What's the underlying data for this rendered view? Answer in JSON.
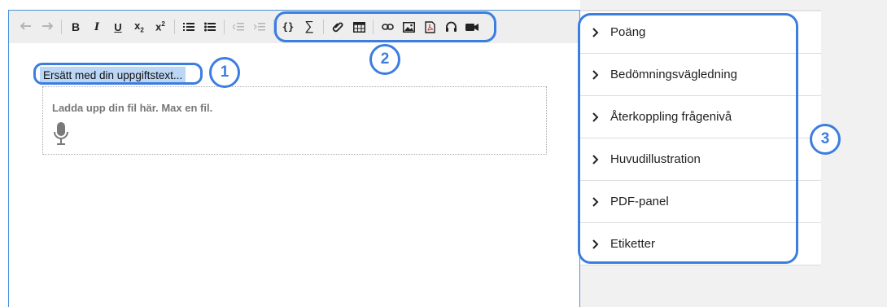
{
  "toolbar": {
    "buttons": [
      {
        "name": "undo-icon",
        "glyph": "↶",
        "enabled": false
      },
      {
        "name": "redo-icon",
        "glyph": "↷",
        "enabled": false
      },
      {
        "name": "bold-icon",
        "glyph": "B",
        "enabled": true
      },
      {
        "name": "italic-icon",
        "glyph": "I",
        "enabled": true
      },
      {
        "name": "underline-icon",
        "glyph": "U",
        "enabled": true
      },
      {
        "name": "subscript-icon",
        "glyph": "x₂",
        "enabled": true
      },
      {
        "name": "superscript-icon",
        "glyph": "x²",
        "enabled": true
      },
      {
        "name": "ordered-list-icon",
        "glyph": "",
        "enabled": true
      },
      {
        "name": "bullet-list-icon",
        "glyph": "",
        "enabled": true
      },
      {
        "name": "outdent-icon",
        "glyph": "",
        "enabled": false
      },
      {
        "name": "indent-icon",
        "glyph": "",
        "enabled": false
      },
      {
        "name": "code-braces-icon",
        "glyph": "{}",
        "enabled": true
      },
      {
        "name": "sigma-icon",
        "glyph": "∑",
        "enabled": true
      },
      {
        "name": "attachment-icon",
        "glyph": "",
        "enabled": true
      },
      {
        "name": "table-icon",
        "glyph": "",
        "enabled": true
      },
      {
        "name": "link-icon",
        "glyph": "",
        "enabled": true
      },
      {
        "name": "image-icon",
        "glyph": "",
        "enabled": true
      },
      {
        "name": "pdf-icon",
        "glyph": "",
        "enabled": true
      },
      {
        "name": "audio-icon",
        "glyph": "",
        "enabled": true
      },
      {
        "name": "video-icon",
        "glyph": "",
        "enabled": true
      }
    ]
  },
  "editor": {
    "selected_text": "Ersätt med din uppgiftstext...",
    "upload_text": "Ladda upp din fil här. Max en fil."
  },
  "sidebar": {
    "items": [
      {
        "label": "Poäng"
      },
      {
        "label": "Bedömningsvägledning"
      },
      {
        "label": "Återkoppling frågenivå"
      },
      {
        "label": "Huvudillustration"
      },
      {
        "label": "PDF-panel"
      },
      {
        "label": "Etiketter"
      }
    ]
  },
  "annotations": {
    "one": "1",
    "two": "2",
    "three": "3",
    "color": "#3b7de0"
  }
}
